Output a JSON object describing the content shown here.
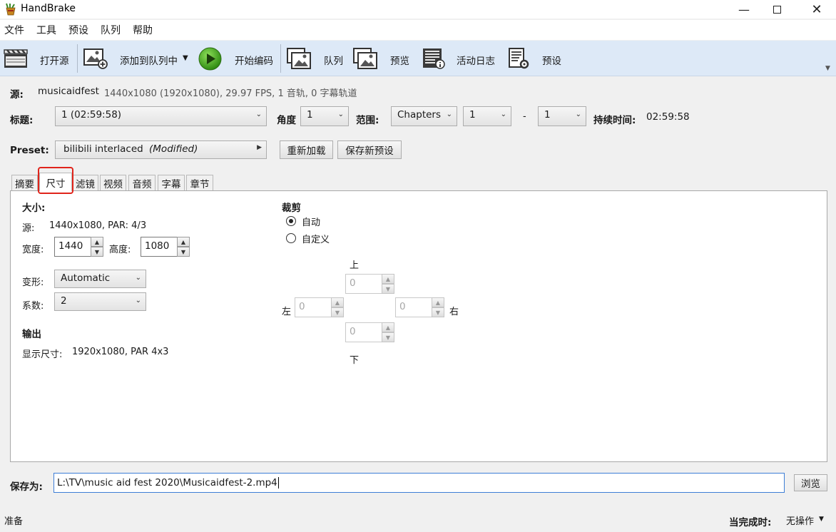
{
  "window": {
    "title": "HandBrake",
    "icon": "pineapple-drink-icon"
  },
  "menu": {
    "items": [
      "文件",
      "工具",
      "预设",
      "队列",
      "帮助"
    ]
  },
  "toolbar": {
    "open_source": "打开源",
    "add_to_queue": "添加到队列中",
    "start_encode": "开始编码",
    "queue": "队列",
    "preview": "预览",
    "activity_log": "活动日志",
    "presets": "预设"
  },
  "source": {
    "label": "源:",
    "name": "musicaidfest",
    "info": "1440x1080 (1920x1080), 29.97 FPS, 1 音轨, 0 字幕轨道"
  },
  "title_row": {
    "title_label": "标题:",
    "title_value": "1 (02:59:58)",
    "angle_label": "角度",
    "angle_value": "1",
    "range_label": "范围:",
    "range_type": "Chapters",
    "range_start": "1",
    "range_dash": "-",
    "range_end": "1",
    "duration_label": "持续时间:",
    "duration_value": "02:59:58"
  },
  "preset_row": {
    "label": "Preset:",
    "value": "bilibili interlaced",
    "modified": "(Modified)",
    "reload": "重新加载",
    "save_new": "保存新预设"
  },
  "tabs": [
    "摘要",
    "尺寸",
    "滤镜",
    "视频",
    "音频",
    "字幕",
    "章节"
  ],
  "dimensions": {
    "size_heading": "大小:",
    "source_label": "源:",
    "source_value": "1440x1080, PAR: 4/3",
    "width_label": "宽度:",
    "width_value": "1440",
    "height_label": "高度:",
    "height_value": "1080",
    "anamorphic_label": "变形:",
    "anamorphic_value": "Automatic",
    "modulus_label": "系数:",
    "modulus_value": "2",
    "output_heading": "输出",
    "display_label": "显示尺寸:",
    "display_value": "1920x1080,  PAR 4x3"
  },
  "cropping": {
    "heading": "裁剪",
    "auto": "自动",
    "custom": "自定义",
    "top_label": "上",
    "bottom_label": "下",
    "left_label": "左",
    "right_label": "右",
    "top": "0",
    "bottom": "0",
    "left": "0",
    "right": "0"
  },
  "save": {
    "label": "保存为:",
    "path": "L:\\TV\\music aid fest 2020\\Musicaidfest-2.mp4",
    "browse": "浏览"
  },
  "status": {
    "left": "准备",
    "when_done_label": "当完成时:",
    "when_done_value": "无操作"
  },
  "colors": {
    "toolbar_bg": "#dde9f7",
    "highlight": "#e0241b",
    "input_focus": "#3d7ed6"
  }
}
